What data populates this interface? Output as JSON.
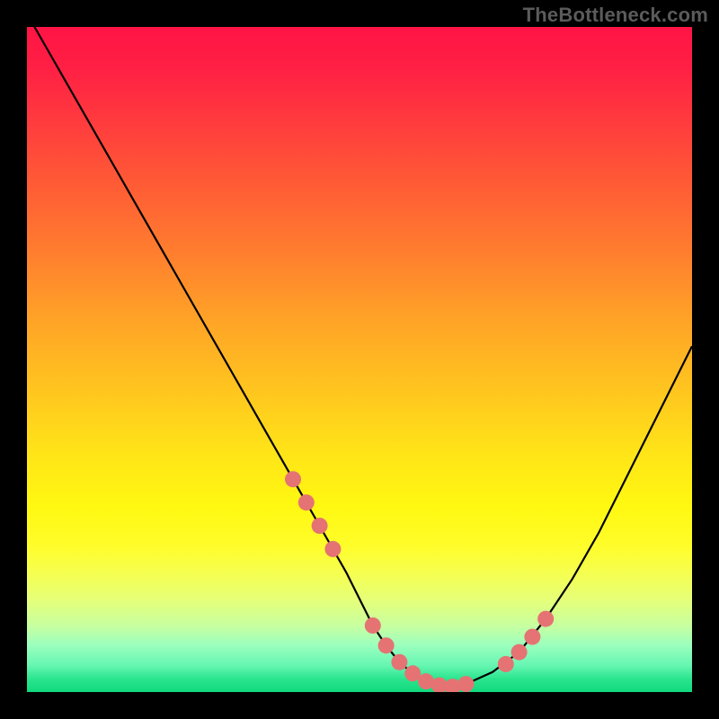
{
  "watermark": "TheBottleneck.com",
  "colors": {
    "curve": "#000000",
    "dot_fill": "#e57373",
    "dot_stroke": "#c85a5a"
  },
  "chart_data": {
    "type": "line",
    "title": "",
    "xlabel": "",
    "ylabel": "",
    "xlim": [
      0,
      100
    ],
    "ylim": [
      0,
      100
    ],
    "series": [
      {
        "name": "bottleneck_curve",
        "x": [
          0,
          4,
          8,
          12,
          16,
          20,
          24,
          28,
          32,
          36,
          40,
          44,
          48,
          50,
          52,
          54,
          56,
          58,
          60,
          62,
          64,
          66,
          70,
          74,
          78,
          82,
          86,
          90,
          94,
          98,
          100
        ],
        "y": [
          102,
          95,
          88,
          81,
          74,
          67,
          60,
          53,
          46,
          39,
          32,
          25,
          18,
          14,
          10,
          7,
          4.5,
          2.8,
          1.6,
          1.0,
          0.8,
          1.2,
          3,
          6,
          11,
          17,
          24,
          32,
          40,
          48,
          52
        ]
      }
    ],
    "highlight_points": {
      "x": [
        40,
        42,
        44,
        46,
        52,
        54,
        56,
        58,
        60,
        62,
        64,
        66,
        72,
        74,
        76,
        78
      ],
      "y": [
        32,
        28.5,
        25,
        21.5,
        10,
        7,
        4.5,
        2.8,
        1.6,
        1.0,
        0.8,
        1.2,
        4.2,
        6,
        8.3,
        11
      ]
    },
    "dot_radius_px": 9
  }
}
